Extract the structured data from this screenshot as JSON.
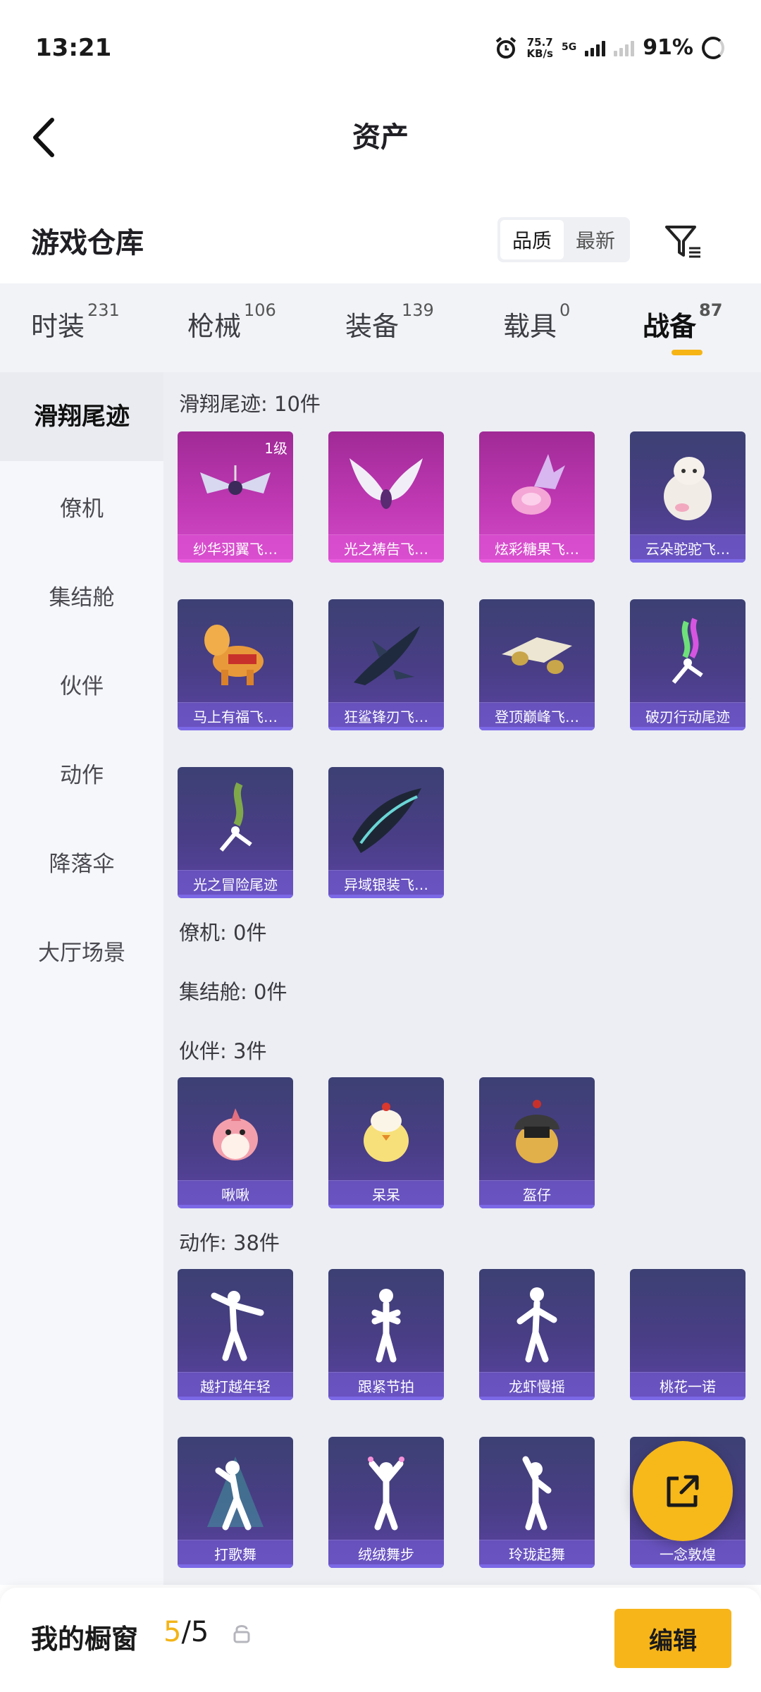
{
  "status_bar": {
    "time": "13:21",
    "speed_value": "75.7",
    "speed_unit": "KB/s",
    "network": "5G",
    "battery": "91%"
  },
  "header": {
    "title": "资产"
  },
  "warehouse": {
    "title": "游戏仓库",
    "sort_options": [
      "品质",
      "最新"
    ],
    "sort_selected": "品质"
  },
  "tabs": [
    {
      "label": "时装",
      "count": "231"
    },
    {
      "label": "枪械",
      "count": "106"
    },
    {
      "label": "装备",
      "count": "139"
    },
    {
      "label": "载具",
      "count": "0"
    },
    {
      "label": "战备",
      "count": "87"
    }
  ],
  "active_tab": "战备",
  "sidebar": {
    "items": [
      "滑翔尾迹",
      "僚机",
      "集结舱",
      "伙伴",
      "动作",
      "降落伞",
      "大厅场景"
    ],
    "active": "滑翔尾迹"
  },
  "sections": {
    "glide": {
      "heading": "滑翔尾迹: 10件",
      "items": [
        {
          "name": "纱华羽翼飞…",
          "tag": "1级",
          "style": "pink"
        },
        {
          "name": "光之祷告飞…",
          "style": "pink"
        },
        {
          "name": "炫彩糖果飞…",
          "style": "pink"
        },
        {
          "name": "云朵驼驼飞…",
          "style": "purple"
        },
        {
          "name": "马上有福飞…",
          "style": "purple"
        },
        {
          "name": "狂鲨锋刃飞…",
          "style": "purple"
        },
        {
          "name": "登顶巅峰飞…",
          "style": "purple"
        },
        {
          "name": "破刃行动尾迹",
          "style": "purple"
        },
        {
          "name": "光之冒险尾迹",
          "style": "purple"
        },
        {
          "name": "异域银装飞…",
          "style": "purple"
        }
      ]
    },
    "wingman": {
      "heading": "僚机: 0件"
    },
    "pod": {
      "heading": "集结舱: 0件"
    },
    "partner": {
      "heading": "伙伴: 3件",
      "items": [
        {
          "name": "啾啾"
        },
        {
          "name": "呆呆"
        },
        {
          "name": "盔仔"
        }
      ]
    },
    "emote": {
      "heading": "动作: 38件",
      "items": [
        {
          "name": "越打越年轻"
        },
        {
          "name": "跟紧节拍"
        },
        {
          "name": "龙虾慢摇"
        },
        {
          "name": "桃花一诺"
        },
        {
          "name": "打歌舞"
        },
        {
          "name": "绒绒舞步"
        },
        {
          "name": "玲珑起舞"
        },
        {
          "name": "一念敦煌"
        }
      ]
    }
  },
  "bottom": {
    "title": "我的橱窗",
    "count_current": "5",
    "count_total": "/5",
    "edit_label": "编辑"
  },
  "colors": {
    "accent": "#f7b51a",
    "card_purple": "#4a3e87",
    "card_pink": "#c23ab6"
  }
}
